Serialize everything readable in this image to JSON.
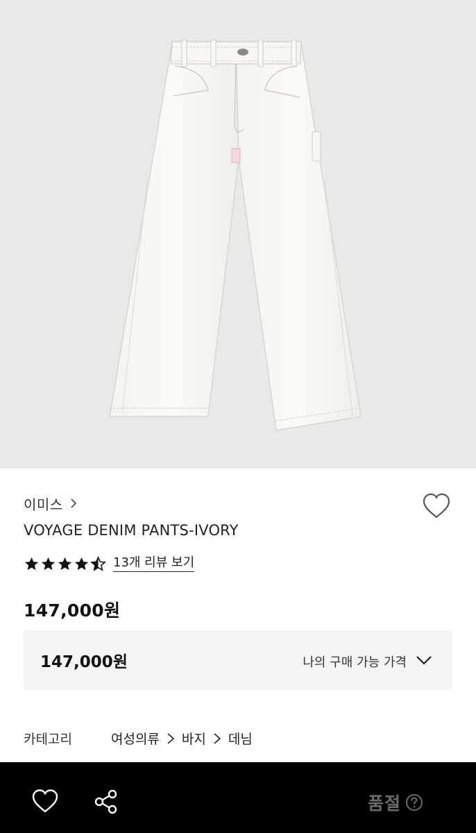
{
  "product": {
    "image_alt": "ivory denim pants",
    "brand": "이미스",
    "name": "VOYAGE DENIM PANTS-IVORY",
    "rating": 4.5,
    "rating_max": 5,
    "review_link": "13개 리뷰 보기",
    "price": "147,000원"
  },
  "my_price": {
    "price": "147,000원",
    "label": "나의 구매 가능 가격"
  },
  "category": {
    "label": "카테고리",
    "path": [
      "여성의류",
      "바지",
      "데님"
    ]
  },
  "bottom_bar": {
    "status": "품절"
  },
  "colors": {
    "image_bg": "#e9e9ea",
    "bottom_bar_bg": "#000000",
    "soldout_text": "#6b6b6b"
  },
  "icons": [
    "chevron-right-icon",
    "heart-outline-icon",
    "star-icon",
    "half-star-icon",
    "chevron-down-icon",
    "share-icon",
    "question-icon"
  ]
}
